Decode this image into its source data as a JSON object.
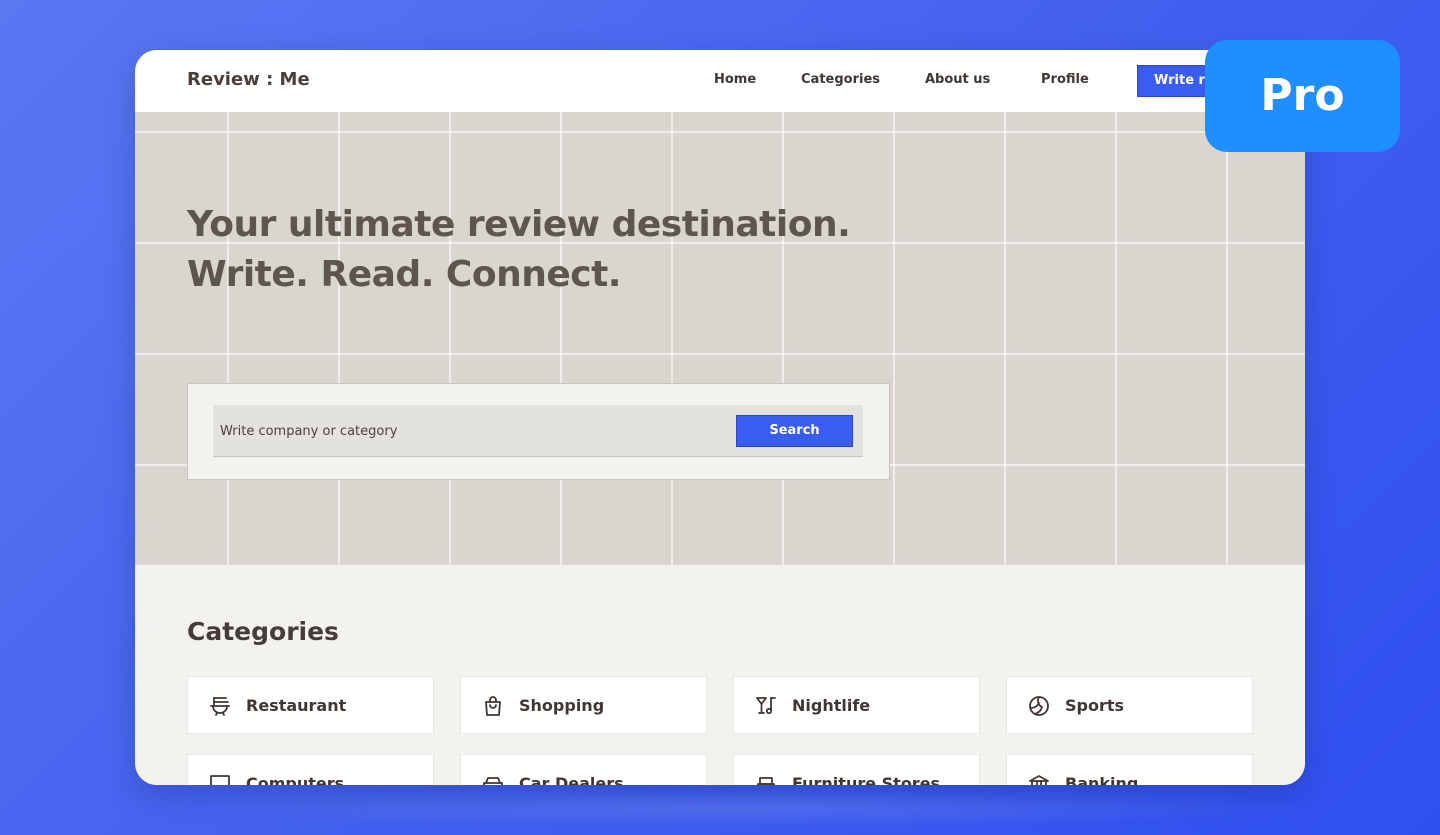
{
  "nav": {
    "brand": "Review : Me",
    "links": [
      "Home",
      "Categories",
      "About us",
      "Profile"
    ],
    "write_button": "Write re"
  },
  "hero": {
    "title_line1": "Your ultimate review destination.",
    "title_line2": "Write. Read. Connect.",
    "search_placeholder": "Write company or category",
    "search_button": "Search"
  },
  "categories": {
    "heading": "Categories",
    "items": [
      {
        "label": "Restaurant",
        "icon": "restaurant-icon"
      },
      {
        "label": "Shopping",
        "icon": "shopping-bag-icon"
      },
      {
        "label": "Nightlife",
        "icon": "nightlife-icon"
      },
      {
        "label": "Sports",
        "icon": "sports-ball-icon"
      },
      {
        "label": "Computers",
        "icon": "computer-icon"
      },
      {
        "label": "Car Dealers",
        "icon": "car-icon"
      },
      {
        "label": "Furniture Stores",
        "icon": "furniture-icon"
      },
      {
        "label": "Banking",
        "icon": "bank-icon"
      }
    ]
  },
  "badge": {
    "label": "Pro"
  },
  "colors": {
    "background": "#4563ef",
    "accent": "#3a5cf0",
    "badge": "#1e8ffc",
    "hero_bg": "#d9d6d0",
    "text_dark": "#3f3733"
  }
}
